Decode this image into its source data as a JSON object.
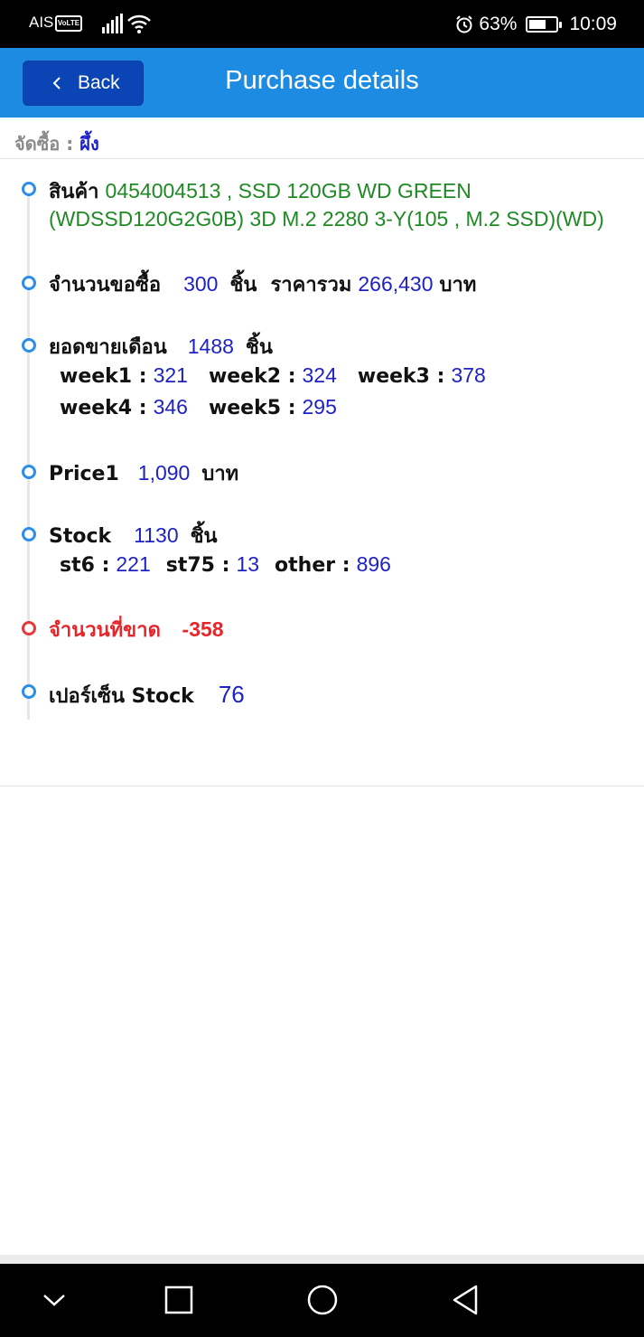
{
  "status_bar": {
    "carrier": "AIS",
    "volte": "VoLTE",
    "battery_percent": "63%",
    "battery_level": 0.63,
    "time": "10:09"
  },
  "header": {
    "back_label": "Back",
    "title": "Purchase details"
  },
  "buyer": {
    "label": "จัดซื้อ :",
    "value": "ผึ้ง"
  },
  "product": {
    "label": "สินค้า",
    "line1": "0454004513 , SSD 120GB WD GREEN",
    "line2": "(WDSSD120G2G0B) 3D M.2 2280 3-Y(105 , M.2 SSD)(WD)"
  },
  "order": {
    "qty_label": "จำนวนขอซื้อ",
    "qty": "300",
    "unit": "ชิ้น",
    "total_label": "ราคารวม",
    "total": "266,430",
    "currency": "บาท"
  },
  "monthly_sales": {
    "label": "ยอดขายเดือน",
    "value": "1488",
    "unit": "ชิ้น",
    "weeks": [
      {
        "label": "week1 :",
        "value": "321"
      },
      {
        "label": "week2 :",
        "value": "324"
      },
      {
        "label": "week3 :",
        "value": "378"
      },
      {
        "label": "week4 :",
        "value": "346"
      },
      {
        "label": "week5 :",
        "value": "295"
      }
    ]
  },
  "price": {
    "label": "Price1",
    "value": "1,090",
    "currency": "บาท"
  },
  "stock": {
    "label": "Stock",
    "value": "1130",
    "unit": "ชิ้น",
    "locations": [
      {
        "label": "st6 :",
        "value": "221"
      },
      {
        "label": "st75 :",
        "value": "13"
      },
      {
        "label": "other :",
        "value": "896"
      }
    ]
  },
  "shortage": {
    "label": "จำนวนที่ขาด",
    "value": "-358"
  },
  "stock_percent": {
    "label": "เปอร์เซ็น Stock",
    "value": "76"
  },
  "icons": {
    "back": "chevron-left-icon",
    "nav": [
      "nav-down-icon",
      "nav-recents-icon",
      "nav-home-icon",
      "nav-back-icon"
    ]
  }
}
